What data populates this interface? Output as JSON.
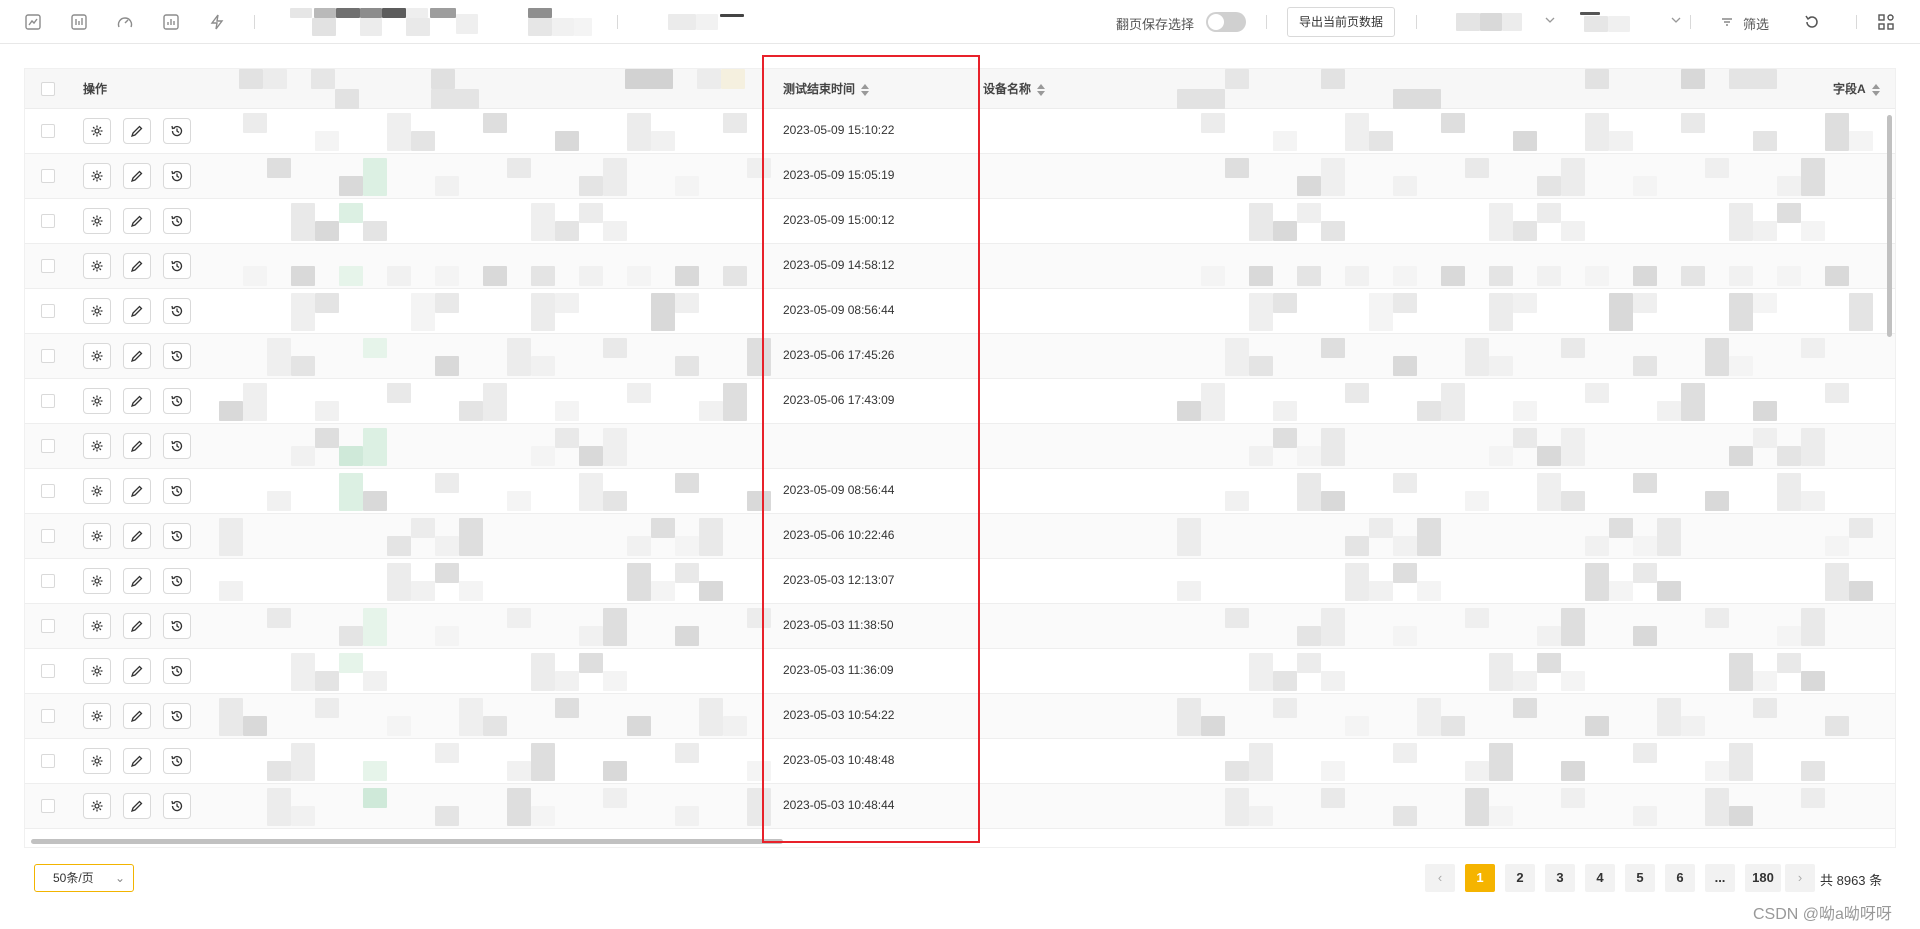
{
  "toolbar": {
    "icons": [
      "trend-icon",
      "chart-box-icon",
      "gauge-icon",
      "bar-chart-icon",
      "lightning-icon"
    ],
    "toggle_label": "翻页保存选择",
    "export_label": "导出当前页数据",
    "filter_label": "筛选"
  },
  "table": {
    "headers": {
      "operation": "操作",
      "end_time": "测试结束时间",
      "device_name": "设备名称",
      "field_a": "字段A"
    },
    "rows": [
      {
        "end_time": "2023-05-09 15:10:22"
      },
      {
        "end_time": "2023-05-09 15:05:19"
      },
      {
        "end_time": "2023-05-09 15:00:12"
      },
      {
        "end_time": "2023-05-09 14:58:12"
      },
      {
        "end_time": "2023-05-09 08:56:44"
      },
      {
        "end_time": "2023-05-06 17:45:26"
      },
      {
        "end_time": "2023-05-06 17:43:09"
      },
      {
        "end_time": ""
      },
      {
        "end_time": "2023-05-09 08:56:44"
      },
      {
        "end_time": "2023-05-06 10:22:46"
      },
      {
        "end_time": "2023-05-03 12:13:07"
      },
      {
        "end_time": "2023-05-03 11:38:50"
      },
      {
        "end_time": "2023-05-03 11:36:09"
      },
      {
        "end_time": "2023-05-03 10:54:22"
      },
      {
        "end_time": "2023-05-03 10:48:48"
      },
      {
        "end_time": "2023-05-03 10:48:44"
      }
    ]
  },
  "pagination": {
    "page_size": "50条/页",
    "pages": [
      "1",
      "2",
      "3",
      "4",
      "5",
      "6",
      "...",
      "180"
    ],
    "current": "1",
    "total": "共 8963 条"
  },
  "watermark": "CSDN @呦a呦呀呀",
  "colors": {
    "accent": "#f5b400",
    "highlight_border": "#e8212a"
  }
}
